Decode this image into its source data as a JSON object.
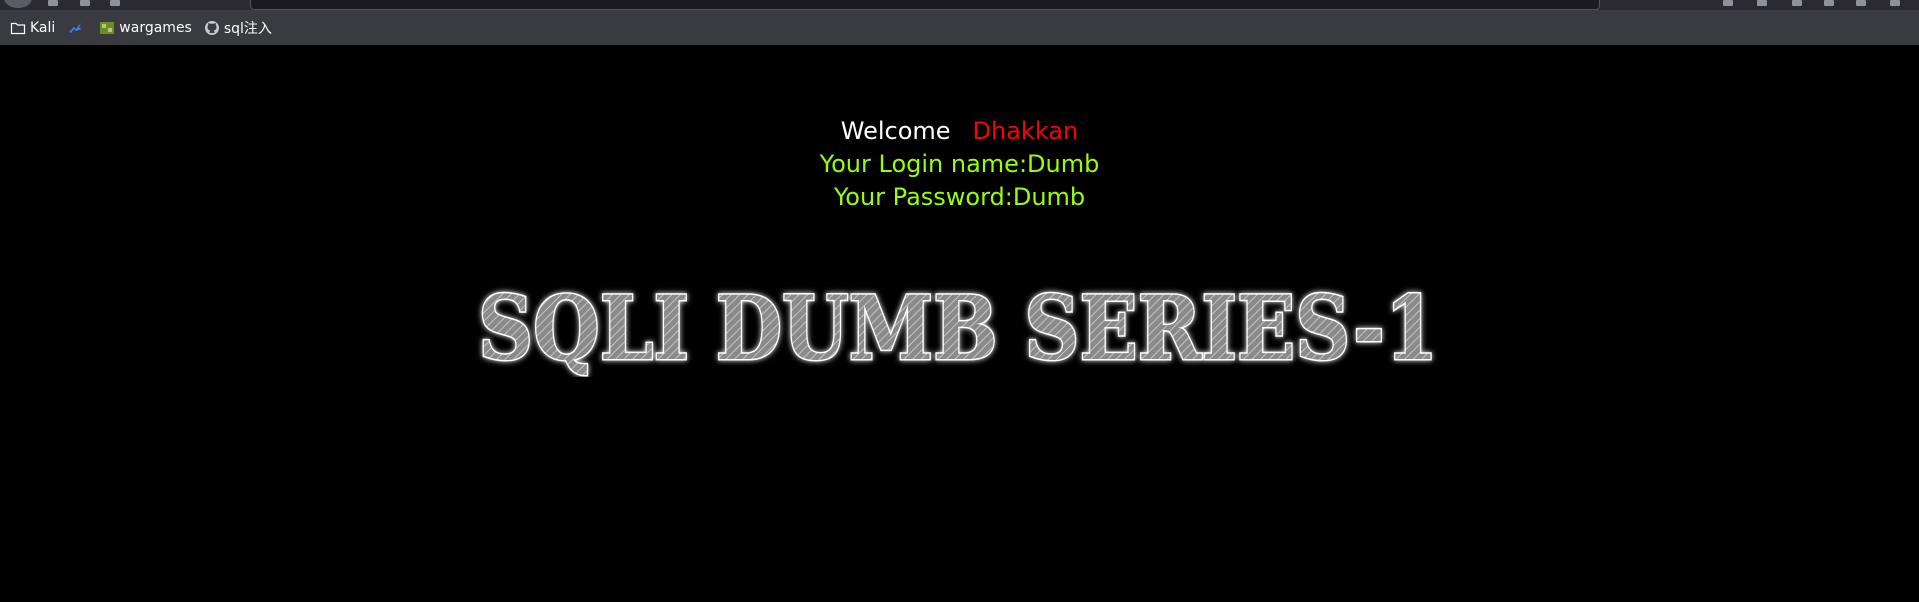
{
  "bookmarks": [
    {
      "label": "Kali",
      "icon": "folder-icon"
    },
    {
      "label": "",
      "icon": "kali-dragon-icon"
    },
    {
      "label": "wargames",
      "icon": "wargames-icon"
    },
    {
      "label": "sql注入",
      "icon": "github-icon"
    }
  ],
  "page": {
    "welcome": "Welcome",
    "name": "Dhakkan",
    "login": "Your Login name:Dumb",
    "password": "Your Password:Dumb",
    "banner": "SQLI DUMB SERIES-1"
  },
  "colors": {
    "background": "#000000",
    "welcome": "#ffffff",
    "name": "#ff0000",
    "credentials": "#99ff00"
  }
}
